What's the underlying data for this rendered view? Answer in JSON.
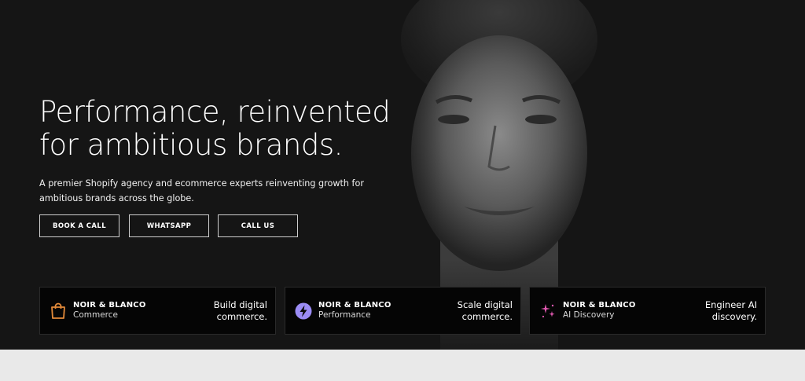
{
  "hero": {
    "headline_line1": "Performance, reinvented",
    "headline_line2": "for ambitious brands.",
    "subtext": "A premier Shopify agency and ecommerce experts reinventing growth for ambitious brands across the globe."
  },
  "cta": {
    "book": "BOOK A CALL",
    "whatsapp": "WHATSAPP",
    "call": "CALL US"
  },
  "cards": [
    {
      "brand": "NOIR & BLANCO",
      "sub": "Commerce",
      "tagline": "Build digital commerce.",
      "icon": "shopping-bag-icon",
      "icon_color": "#e38a3a"
    },
    {
      "brand": "NOIR & BLANCO",
      "sub": "Performance",
      "tagline": "Scale digital commerce.",
      "icon": "lightning-bolt-icon",
      "icon_color": "#9b8cf5"
    },
    {
      "brand": "NOIR & BLANCO",
      "sub": "AI Discovery",
      "tagline": "Engineer AI discovery.",
      "icon": "sparkles-icon",
      "icon_color": "#e65ab4"
    }
  ],
  "colors": {
    "hero_background": "#151515",
    "card_background": "#050505",
    "page_background": "#e9e9e9"
  }
}
